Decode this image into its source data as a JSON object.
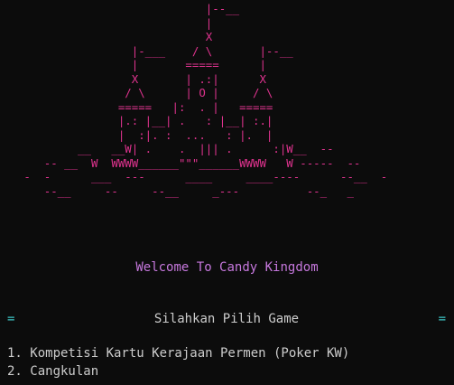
{
  "castle_art": [
    "                              |--__",
    "                              |",
    "                              X",
    "                   |-___    / \\       |--__",
    "                   |       =====      |",
    "                   X       | .:|      X",
    "                  / \\      | O |     / \\",
    "                 =====   |:  . |   =====",
    "                 |.: |__| .   : |__| :.|",
    "                 |  :|. :  ...   : |.  |",
    "           __   __W| .    .  ||| .      :|W__  --",
    "      -- __  W  WWWW______\"\"\"______WWWW   W -----  --",
    "   -  -      ___  ---      ____     ____----      --__  -",
    "      --__     --     --__     _---          --_   _"
  ],
  "welcome_text": "Welcome To Candy Kingdom",
  "menu": {
    "title": "Silahkan Pilih Game",
    "edge_char": "=",
    "rule_text": "================================================================",
    "items": [
      "1. Kompetisi Kartu Kerajaan Permen (Poker KW)",
      "2. Cangkulan"
    ]
  },
  "colors": {
    "background": "#0c0c0c",
    "art": "#e0338f",
    "welcome": "#c678dd",
    "rule": "#3bc4c4",
    "text": "#cccccc"
  }
}
